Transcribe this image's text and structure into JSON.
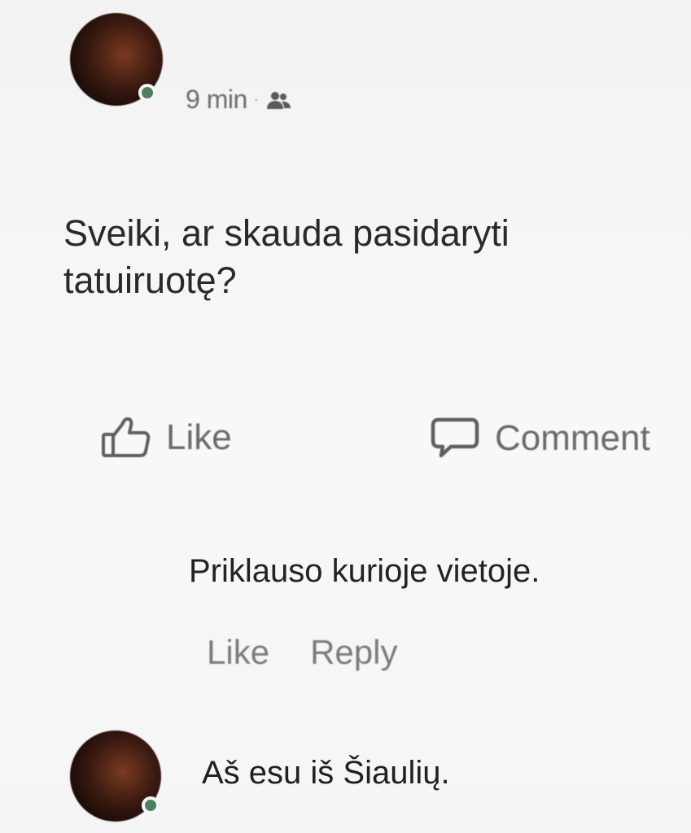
{
  "post": {
    "time": "9 min",
    "separator": "·",
    "audience_icon": "friends-icon",
    "text": "Sveiki, ar skauda pasidaryti tatuiruotę?"
  },
  "actions": {
    "like_label": "Like",
    "like_icon": "thumbs-up-icon",
    "comment_label": "Comment",
    "comment_icon": "comment-bubble-icon"
  },
  "reply": {
    "text": "Priklauso kurioje vietoje.",
    "like_label": "Like",
    "reply_label": "Reply"
  },
  "bottom_comment": {
    "text": "Aš esu iš Šiaulių."
  },
  "colors": {
    "online_dot": "#4f7f5f",
    "text_primary": "#2a2a2a",
    "text_secondary": "#6d6d6d"
  }
}
